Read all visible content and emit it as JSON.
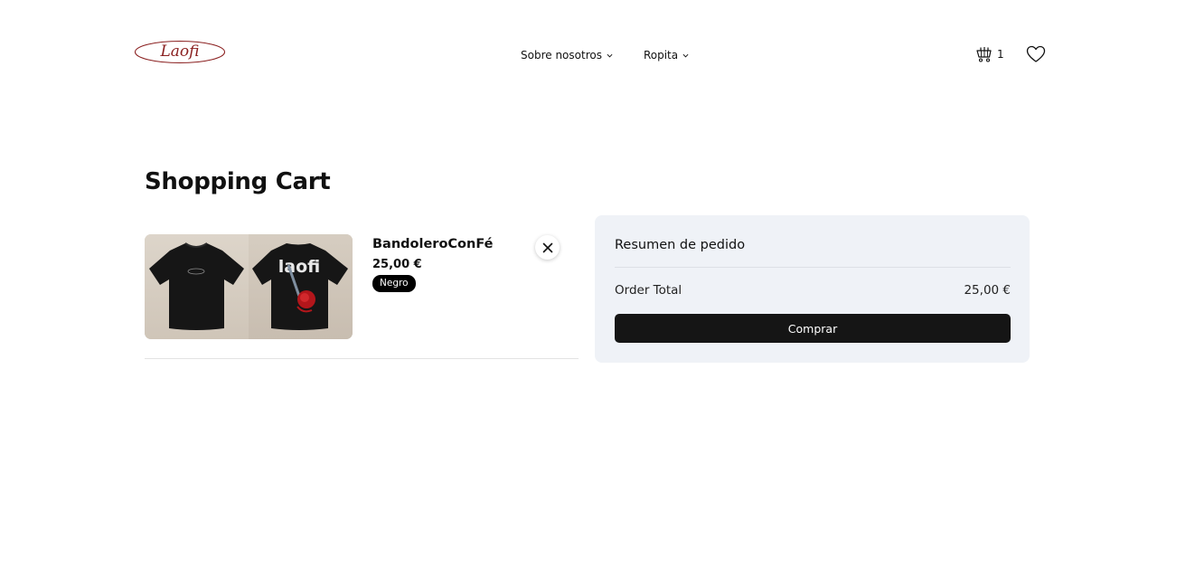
{
  "brand": {
    "logo_text": "Laofi",
    "logo_color": "#8a1f1f"
  },
  "nav": {
    "items": [
      {
        "label": "Sobre nosotros"
      },
      {
        "label": "Ropita"
      }
    ]
  },
  "header_actions": {
    "cart_icon": "shopping-basket-icon",
    "cart_count": "1",
    "wishlist_icon": "heart-icon"
  },
  "page": {
    "title": "Shopping Cart"
  },
  "cart": {
    "items": [
      {
        "name": "BandoleroConFé",
        "price": "25,00 €",
        "variant": "Negro",
        "image_text": "laofi",
        "remove_icon": "close-icon"
      }
    ]
  },
  "summary": {
    "title": "Resumen de pedido",
    "total_label": "Order Total",
    "total_value": "25,00 €",
    "buy_label": "Comprar"
  },
  "colors": {
    "accent_dark": "#151515",
    "summary_bg": "#eff2f7",
    "badge_bg": "#000000"
  }
}
